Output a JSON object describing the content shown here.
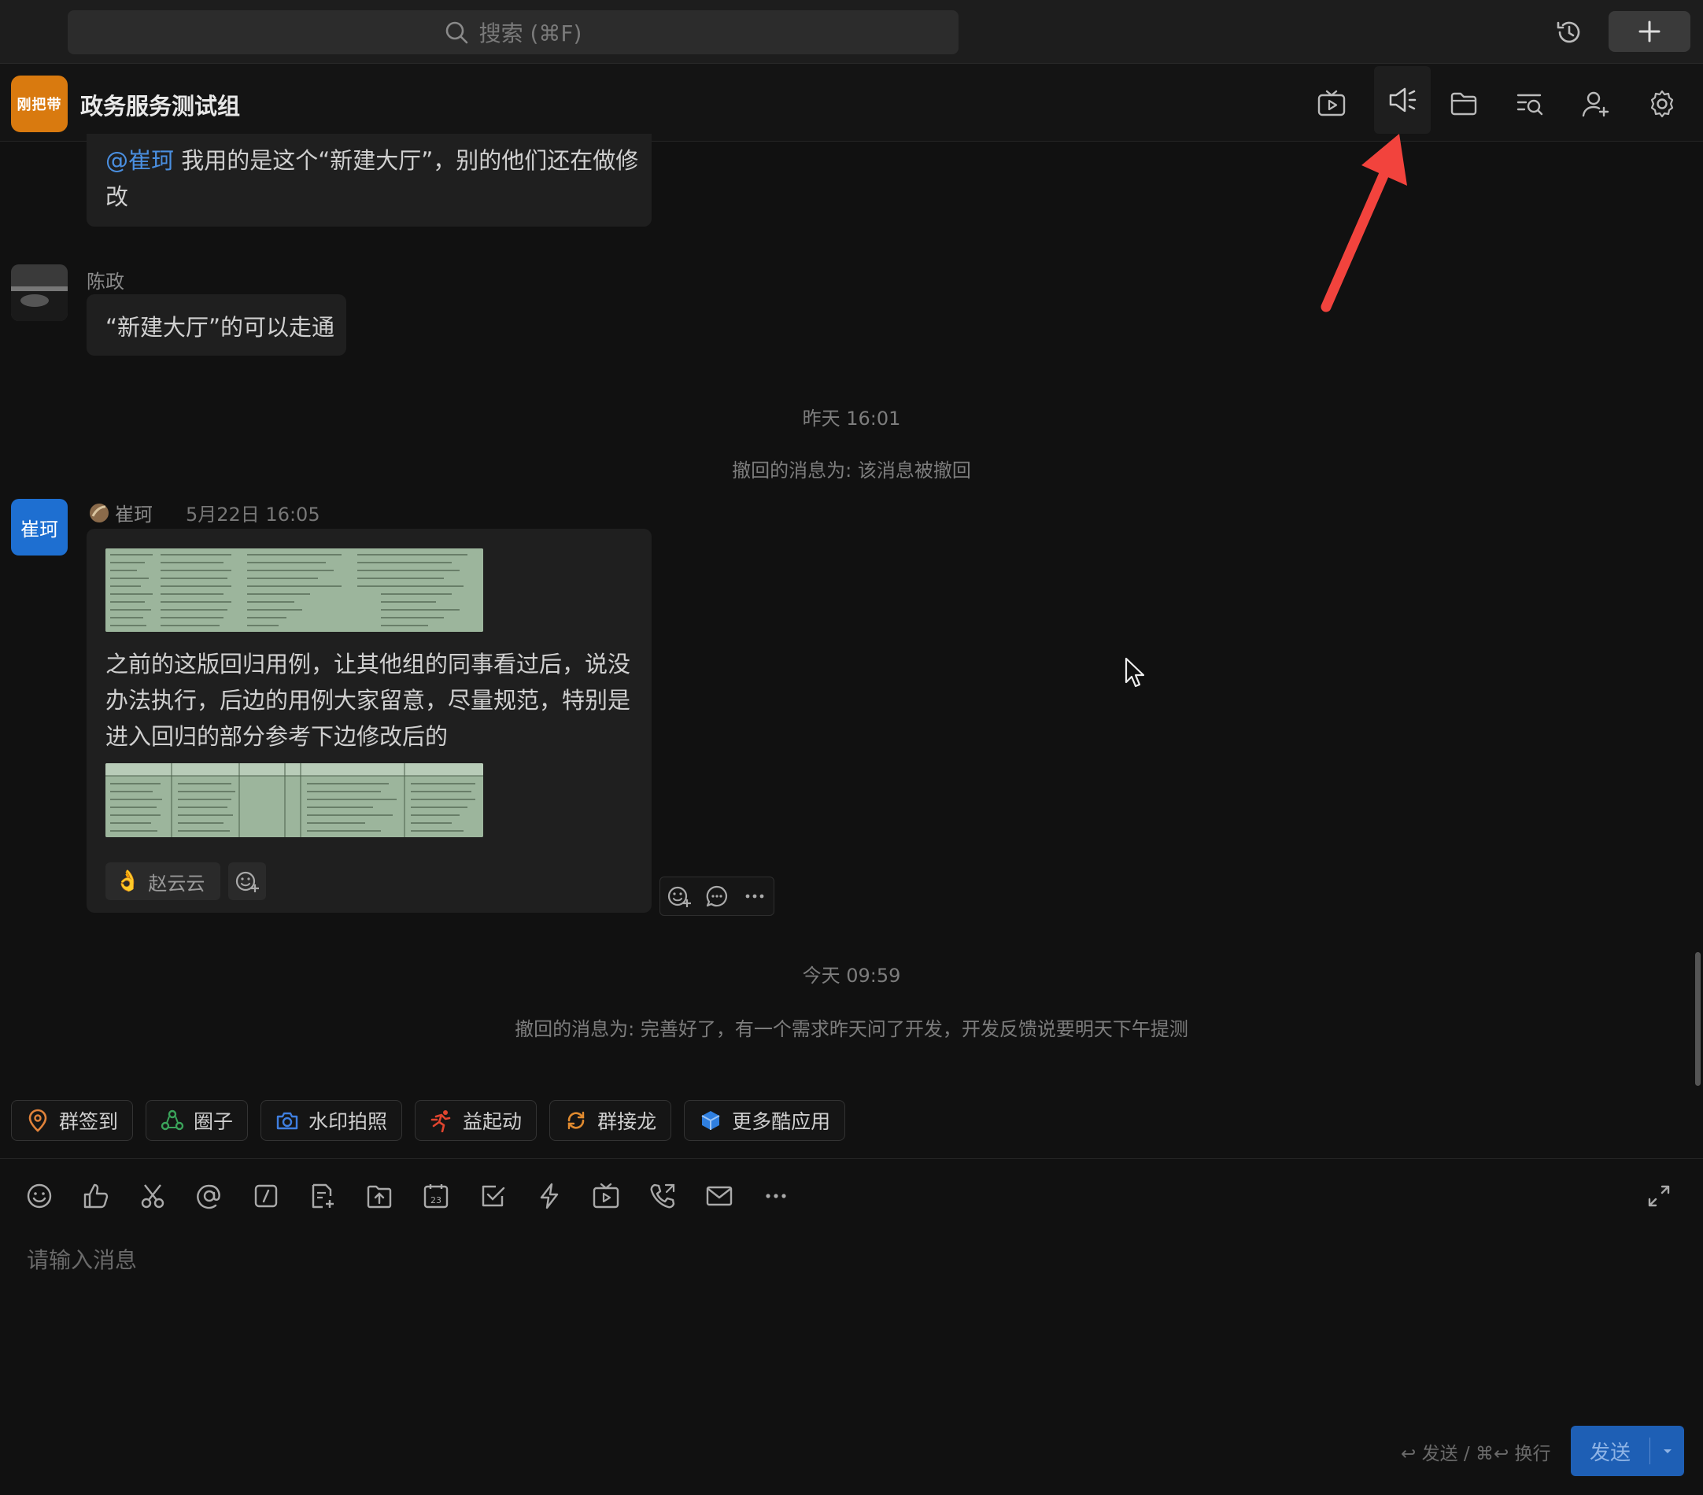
{
  "search": {
    "placeholder": "搜索 (⌘F)"
  },
  "chat": {
    "title": "政务服务测试组",
    "avatar_text": "刚把带"
  },
  "messages": {
    "m1": {
      "mention": "@崔珂",
      "text_line1": " 我用的是这个“新建大厅”，别的他们还在做修",
      "text_line2": "改"
    },
    "m2": {
      "sender": "陈政",
      "text": "“新建大厅”的可以走通"
    },
    "sys1": {
      "time": "昨天 16:01",
      "recall": "撤回的消息为: 该消息被撤回"
    },
    "m3": {
      "avatar_text": "崔珂",
      "sender": "崔珂",
      "time": "5月22日 16:05",
      "text_line1": "之前的这版回归用例，让其他组的同事看过后，说没",
      "text_line2": "办法执行，后边的用例大家留意，尽量规范，特别是",
      "text_line3": "进入回归的部分参考下边修改后的",
      "reaction_user": "赵云云"
    },
    "sys2": {
      "time": "今天 09:59",
      "recall": "撤回的消息为: 完善好了，有一个需求昨天问了开发，开发反馈说要明天下午提测"
    }
  },
  "apps": [
    {
      "label": "群签到",
      "icon": "location-pin-icon",
      "color": "#e0823a"
    },
    {
      "label": "圈子",
      "icon": "circle-group-icon",
      "color": "#3aa35a"
    },
    {
      "label": "水印拍照",
      "icon": "camera-icon",
      "color": "#3f7fe0"
    },
    {
      "label": "益起动",
      "icon": "runner-icon",
      "color": "#e0452f"
    },
    {
      "label": "群接龙",
      "icon": "relay-icon",
      "color": "#e08a2f"
    },
    {
      "label": "更多酷应用",
      "icon": "cube-apps-icon",
      "color": "#2f7fe0"
    }
  ],
  "composer": {
    "placeholder": "请输入消息",
    "hint": "↩ 发送 / ⌘↩ 换行",
    "send_label": "发送"
  },
  "colors": {
    "accent": "#1e5fb5",
    "mention": "#4a8fe0",
    "arrow": "#f2433d"
  }
}
